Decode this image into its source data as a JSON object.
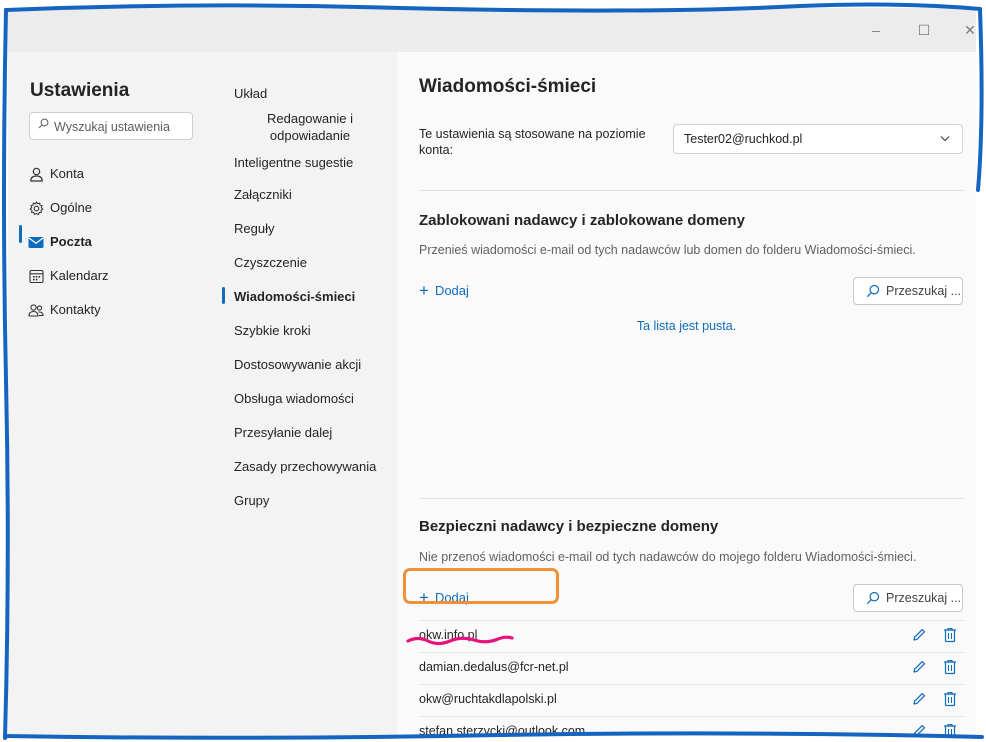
{
  "window": {
    "minimize": "–",
    "maximize": "☐",
    "close": "✕"
  },
  "sidebar": {
    "title": "Ustawienia",
    "search_placeholder": "Wyszukaj ustawienia",
    "items": [
      {
        "label": "Konta",
        "icon": "person-icon"
      },
      {
        "label": "Ogólne",
        "icon": "gear-icon"
      },
      {
        "label": "Poczta",
        "icon": "mail-icon",
        "active": true
      },
      {
        "label": "Kalendarz",
        "icon": "calendar-icon"
      },
      {
        "label": "Kontakty",
        "icon": "people-icon"
      }
    ]
  },
  "subnav": {
    "items": [
      "Układ",
      "Redagowanie i odpowiadanie",
      "Inteligentne sugestie",
      "Załączniki",
      "Reguły",
      "Czyszczenie",
      "Wiadomości-śmieci",
      "Szybkie kroki",
      "Dostosowywanie akcji",
      "Obsługa wiadomości",
      "Przesyłanie dalej",
      "Zasady przechowywania",
      "Grupy"
    ],
    "active": "Wiadomości-śmieci",
    "item_1_line1": "Redagowanie i",
    "item_1_line2": "odpowiadanie"
  },
  "main": {
    "title": "Wiadomości-śmieci",
    "scope_label": "Te ustawienia są stosowane na poziomie konta:",
    "account": "Tester02@ruchkod.pl",
    "blocked": {
      "title": "Zablokowani nadawcy i zablokowane domeny",
      "description": "Przenieś wiadomości e-mail od tych nadawców lub domen do folderu Wiadomości-śmieci.",
      "add_label": "Dodaj",
      "search_label": "Przeszukaj ...",
      "empty_message": "Ta lista jest pusta."
    },
    "safe": {
      "title": "Bezpieczni nadawcy i bezpieczne domeny",
      "description": "Nie przenoś wiadomości e-mail od tych nadawców do mojego folderu Wiadomości-śmieci.",
      "add_label": "Dodaj",
      "search_label": "Przeszukaj ...",
      "entries": [
        "okw.info.pl",
        "damian.dedalus@fcr-net.pl",
        "okw@ruchtakdlapolski.pl",
        "stefan.sterzycki@outlook.com"
      ]
    }
  },
  "colors": {
    "accent": "#0f6cbd",
    "annotation_box": "#f0913a",
    "annotation_underline": "#e8127c",
    "frame_border": "#1565c0"
  }
}
